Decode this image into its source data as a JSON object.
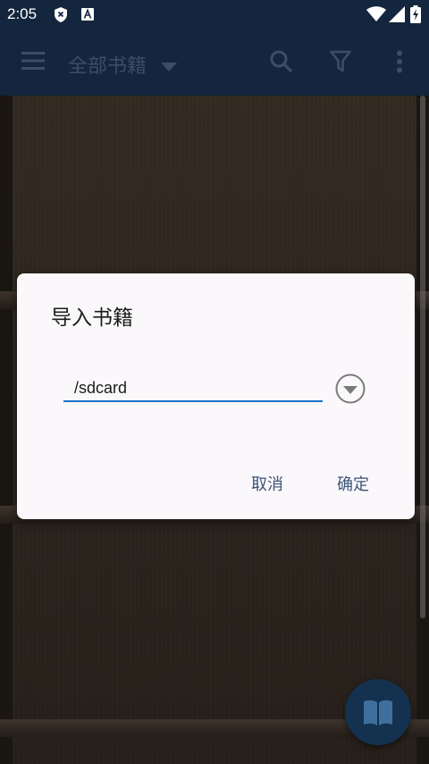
{
  "status_bar": {
    "time": "2:05",
    "icons": [
      "shield-x-icon",
      "font-a-icon",
      "wifi-icon",
      "signal-icon",
      "battery-charging-icon"
    ]
  },
  "app_bar": {
    "title": "全部书籍",
    "icons": [
      "menu-icon",
      "dropdown-arrow-icon",
      "search-icon",
      "filter-icon",
      "more-vert-icon"
    ]
  },
  "dialog": {
    "title": "导入书籍",
    "path_value": "/sdcard",
    "cancel_label": "取消",
    "ok_label": "确定"
  },
  "fab": {
    "icon": "open-book-icon"
  },
  "colors": {
    "appbar_bg": "#14263d",
    "accent_underline": "#1a73c8",
    "button_text": "#3a5478",
    "fab_bg": "#14314f",
    "shelf_bg": "#3d3228"
  }
}
